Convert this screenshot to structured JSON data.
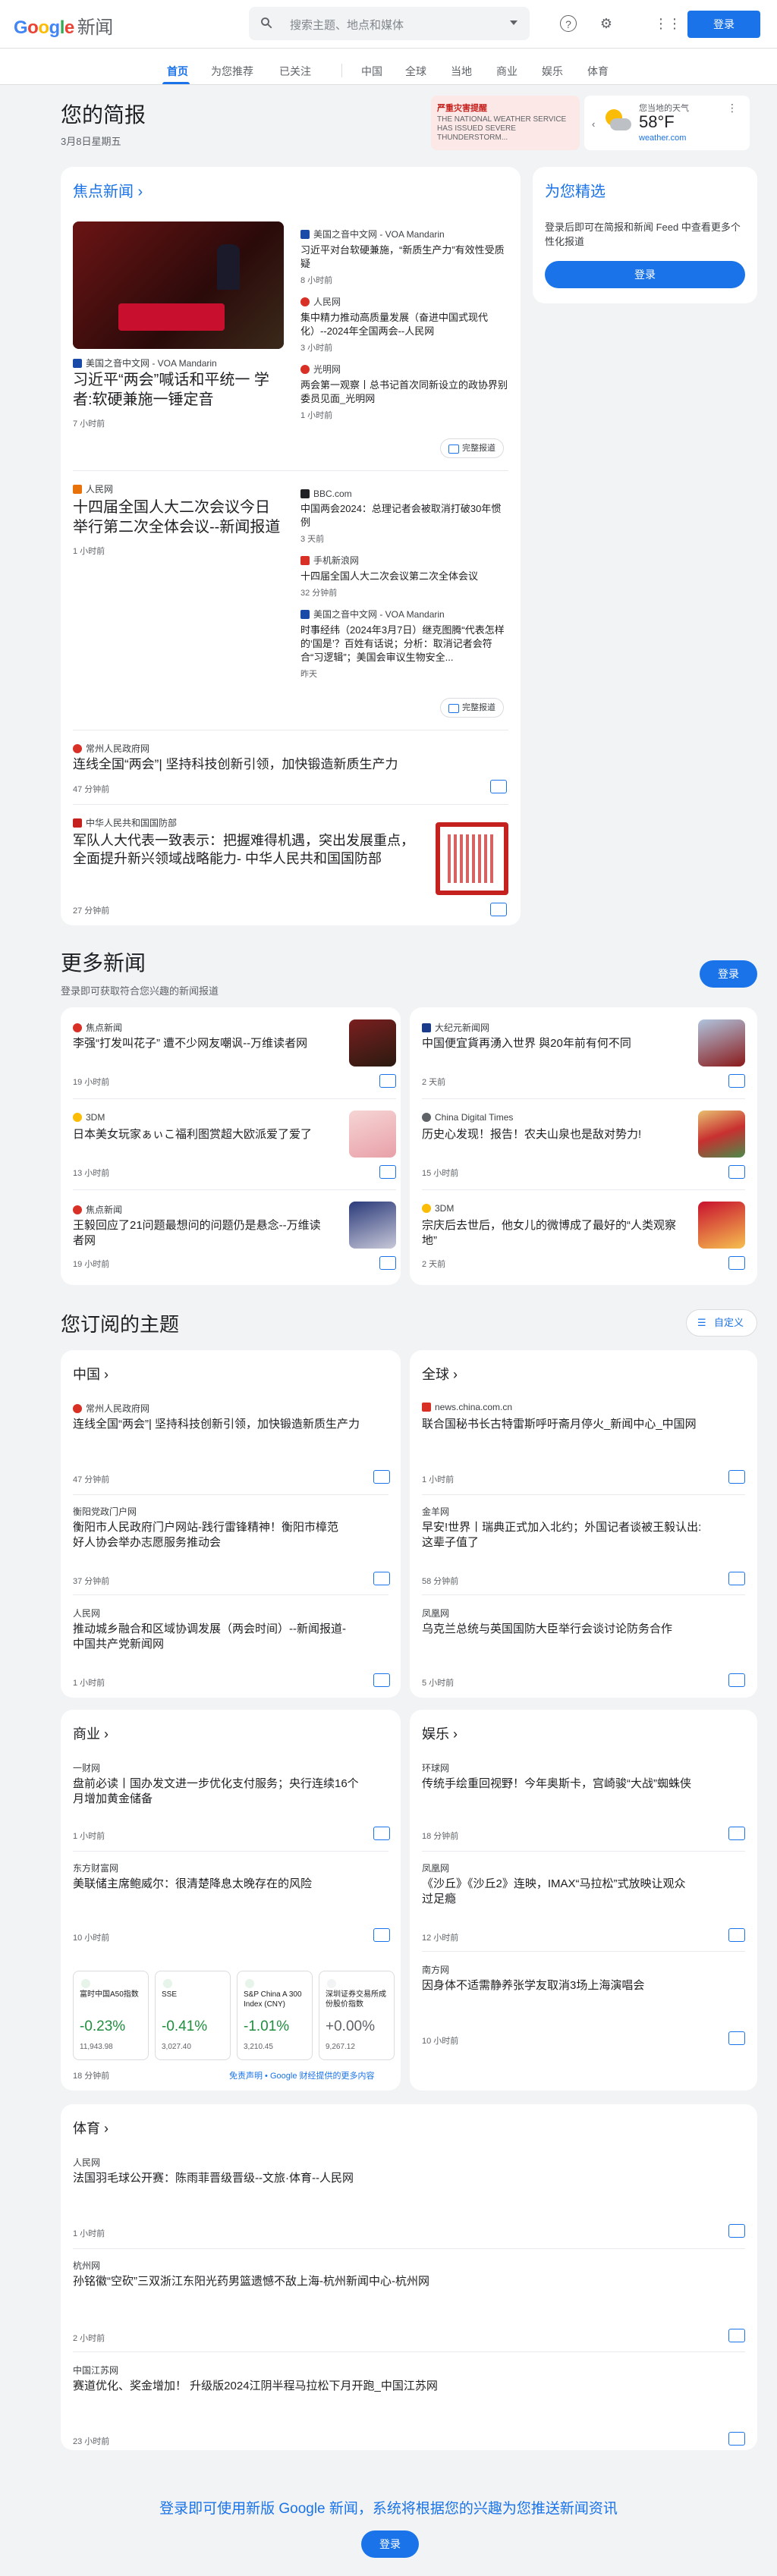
{
  "header": {
    "logo": "Google",
    "product": "新闻",
    "search_placeholder": "搜索主题、地点和媒体",
    "login": "登录"
  },
  "nav": [
    "首页",
    "为您推荐",
    "已关注",
    "中国",
    "全球",
    "当地",
    "商业",
    "娱乐",
    "体育"
  ],
  "brief": {
    "title": "您的简报",
    "date": "3月8日星期五"
  },
  "alert": {
    "title": "严重灾害提醒",
    "text": "THE NATIONAL WEATHER SERVICE HAS ISSUED SEVERE THUNDERSTORM..."
  },
  "weather": {
    "label": "您当地的天气",
    "temp": "58°F",
    "source": "weather.com"
  },
  "top": {
    "title": "焦点新闻",
    "s1": {
      "src": "美国之音中文网 - VOA Mandarin",
      "hd": "习近平“两会”喊话和平统一 学者:软硬兼施一锤定音",
      "tm": "7 小时前",
      "rel": [
        {
          "src": "美国之音中文网 - VOA Mandarin",
          "hd": "习近平对台软硬兼施，“新质生产力”有效性受质疑",
          "tm": "8 小时前"
        },
        {
          "src": "人民网",
          "hd": "集中精力推动高质量发展（奋进中国式现代化）--2024年全国两会--人民网",
          "tm": "3 小时前"
        },
        {
          "src": "光明网",
          "hd": "两会第一观察丨总书记首次同新设立的政协界别委员见面_光明网",
          "tm": "1 小时前"
        }
      ]
    },
    "s2": {
      "src": "人民网",
      "hd": "十四届全国人大二次会议今日举行第二次全体会议--新闻报道",
      "tm": "1 小时前",
      "rel": [
        {
          "src": "BBC.com",
          "hd": "中国两会2024：总理记者会被取消打破30年惯例",
          "tm": "3 天前"
        },
        {
          "src": "手机新浪网",
          "hd": "十四届全国人大二次会议第二次全体会议",
          "tm": "32 分钟前"
        },
        {
          "src": "美国之音中文网 - VOA Mandarin",
          "hd": "时事经纬（2024年3月7日）继克图腾“代表怎样的‘国是’？百姓有话说；分析：取消记者会符合“习逻辑”；美国会审议生物安全...",
          "tm": "昨天"
        }
      ]
    },
    "full": "完整报道",
    "s3": {
      "src": "常州人民政府网",
      "hd": "连线全国“两会”| 坚持科技创新引领，加快锻造新质生产力",
      "tm": "47 分钟前"
    },
    "s4": {
      "src": "中华人民共和国国防部",
      "hd": "军队人大代表一致表示：把握难得机遇，突出发展重点，全面提升新兴领域战略能力- 中华人民共和国国防部",
      "tm": "27 分钟前"
    }
  },
  "picks": {
    "title": "为您精选",
    "text": "登录后即可在简报和新闻 Feed 中查看更多个性化报道",
    "btn": "登录"
  },
  "more": {
    "title": "更多新闻",
    "sub": "登录即可获取符合您兴趣的新闻报道",
    "btn": "登录",
    "items": [
      {
        "src": "焦点新闻",
        "hd": "李强“打发叫花子” 遭不少网友嘲讽--万维读者网",
        "tm": "19 小时前"
      },
      {
        "src": "大纪元新闻网",
        "hd": "中国便宜貨再湧入世界 與20年前有何不同",
        "tm": "2 天前"
      },
      {
        "src": "3DM",
        "hd": "日本美女玩家ぁぃこ福利图赏超大欧派爱了爱了",
        "tm": "13 小时前"
      },
      {
        "src": "China Digital Times",
        "hd": "历史心发现！报告！农夫山泉也是敌对势力!",
        "tm": "15 小时前"
      },
      {
        "src": "焦点新闻",
        "hd": "王毅回应了21问题最想问的问题仍是悬念--万维读者网",
        "tm": "19 小时前"
      },
      {
        "src": "3DM",
        "hd": "宗庆后去世后，他女儿的微博成了最好的“人类观察地”",
        "tm": "2 天前"
      }
    ]
  },
  "topics": {
    "title": "您订阅的主题",
    "custom": "自定义",
    "china": {
      "title": "中国",
      "items": [
        {
          "src": "常州人民政府网",
          "hd": "连线全国“两会”| 坚持科技创新引领，加快锻造新质生产力",
          "tm": "47 分钟前"
        },
        {
          "src": "衡阳党政门户网",
          "hd": "衡阳市人民政府门户网站-践行雷锋精神！衡阳市樟范好人协会举办志愿服务推动会",
          "tm": "37 分钟前"
        },
        {
          "src": "人民网",
          "hd": "推动城乡融合和区域协调发展（两会时间）--新闻报道-中国共产党新闻网",
          "tm": "1 小时前"
        }
      ]
    },
    "world": {
      "title": "全球",
      "items": [
        {
          "src": "news.china.com.cn",
          "hd": "联合国秘书长古特雷斯呼吁斋月停火_新闻中心_中国网",
          "tm": "1 小时前"
        },
        {
          "src": "金羊网",
          "hd": "早安!世界丨瑞典正式加入北约；外国记者谈被王毅认出:这辈子值了",
          "tm": "58 分钟前"
        },
        {
          "src": "凤凰网",
          "hd": "乌克兰总统与英国国防大臣举行会谈讨论防务合作",
          "tm": "5 小时前"
        }
      ]
    },
    "biz": {
      "title": "商业",
      "items": [
        {
          "src": "一财网",
          "hd": "盘前必读丨国办发文进一步优化支付服务；央行连续16个月增加黄金储备",
          "tm": "1 小时前"
        },
        {
          "src": "东方财富网",
          "hd": "美联储主席鲍威尔：很清楚降息太晚存在的风险",
          "tm": "10 小时前"
        }
      ],
      "stocks": [
        {
          "name": "富时中国A50指数",
          "pct": "-0.23%",
          "val": "11,943.98"
        },
        {
          "name": "SSE",
          "pct": "-0.41%",
          "val": "3,027.40"
        },
        {
          "name": "S&P China A 300 Index (CNY)",
          "pct": "-1.01%",
          "val": "3,210.45"
        },
        {
          "name": "深圳证券交易所成份股价指数",
          "pct": "+0.00%",
          "val": "9,267.12"
        }
      ],
      "stock_tm": "18 分钟前",
      "disclaimer": "免责声明 • Google 财经提供的更多内容"
    },
    "ent": {
      "title": "娱乐",
      "items": [
        {
          "src": "环球网",
          "hd": "传统手绘重回视野！今年奥斯卡，宫崎骏“大战”蜘蛛侠",
          "tm": "18 分钟前"
        },
        {
          "src": "凤凰网",
          "hd": "《沙丘》《沙丘2》连映，IMAX“马拉松”式放映让观众过足瘾",
          "tm": "12 小时前"
        },
        {
          "src": "南方网",
          "hd": "因身体不适需静养张学友取消3场上海演唱会",
          "tm": "10 小时前"
        }
      ]
    },
    "sport": {
      "title": "体育",
      "items": [
        {
          "src": "人民网",
          "hd": "法国羽毛球公开赛：陈雨菲晋级晋级--文旅·体育--人民网",
          "tm": "1 小时前"
        },
        {
          "src": "杭州网",
          "hd": "孙铭徽“空砍”三双浙江东阳光药男篮遗憾不敌上海-杭州新闻中心-杭州网",
          "tm": "2 小时前"
        },
        {
          "src": "中国江苏网",
          "hd": "赛道优化、奖金增加！ 升级版2024江阴半程马拉松下月开跑_中国江苏网",
          "tm": "23 小时前"
        }
      ]
    }
  },
  "footer": {
    "text": "登录即可使用新版 Google 新闻，系统将根据您的兴趣为您推送新闻资讯",
    "btn": "登录"
  }
}
